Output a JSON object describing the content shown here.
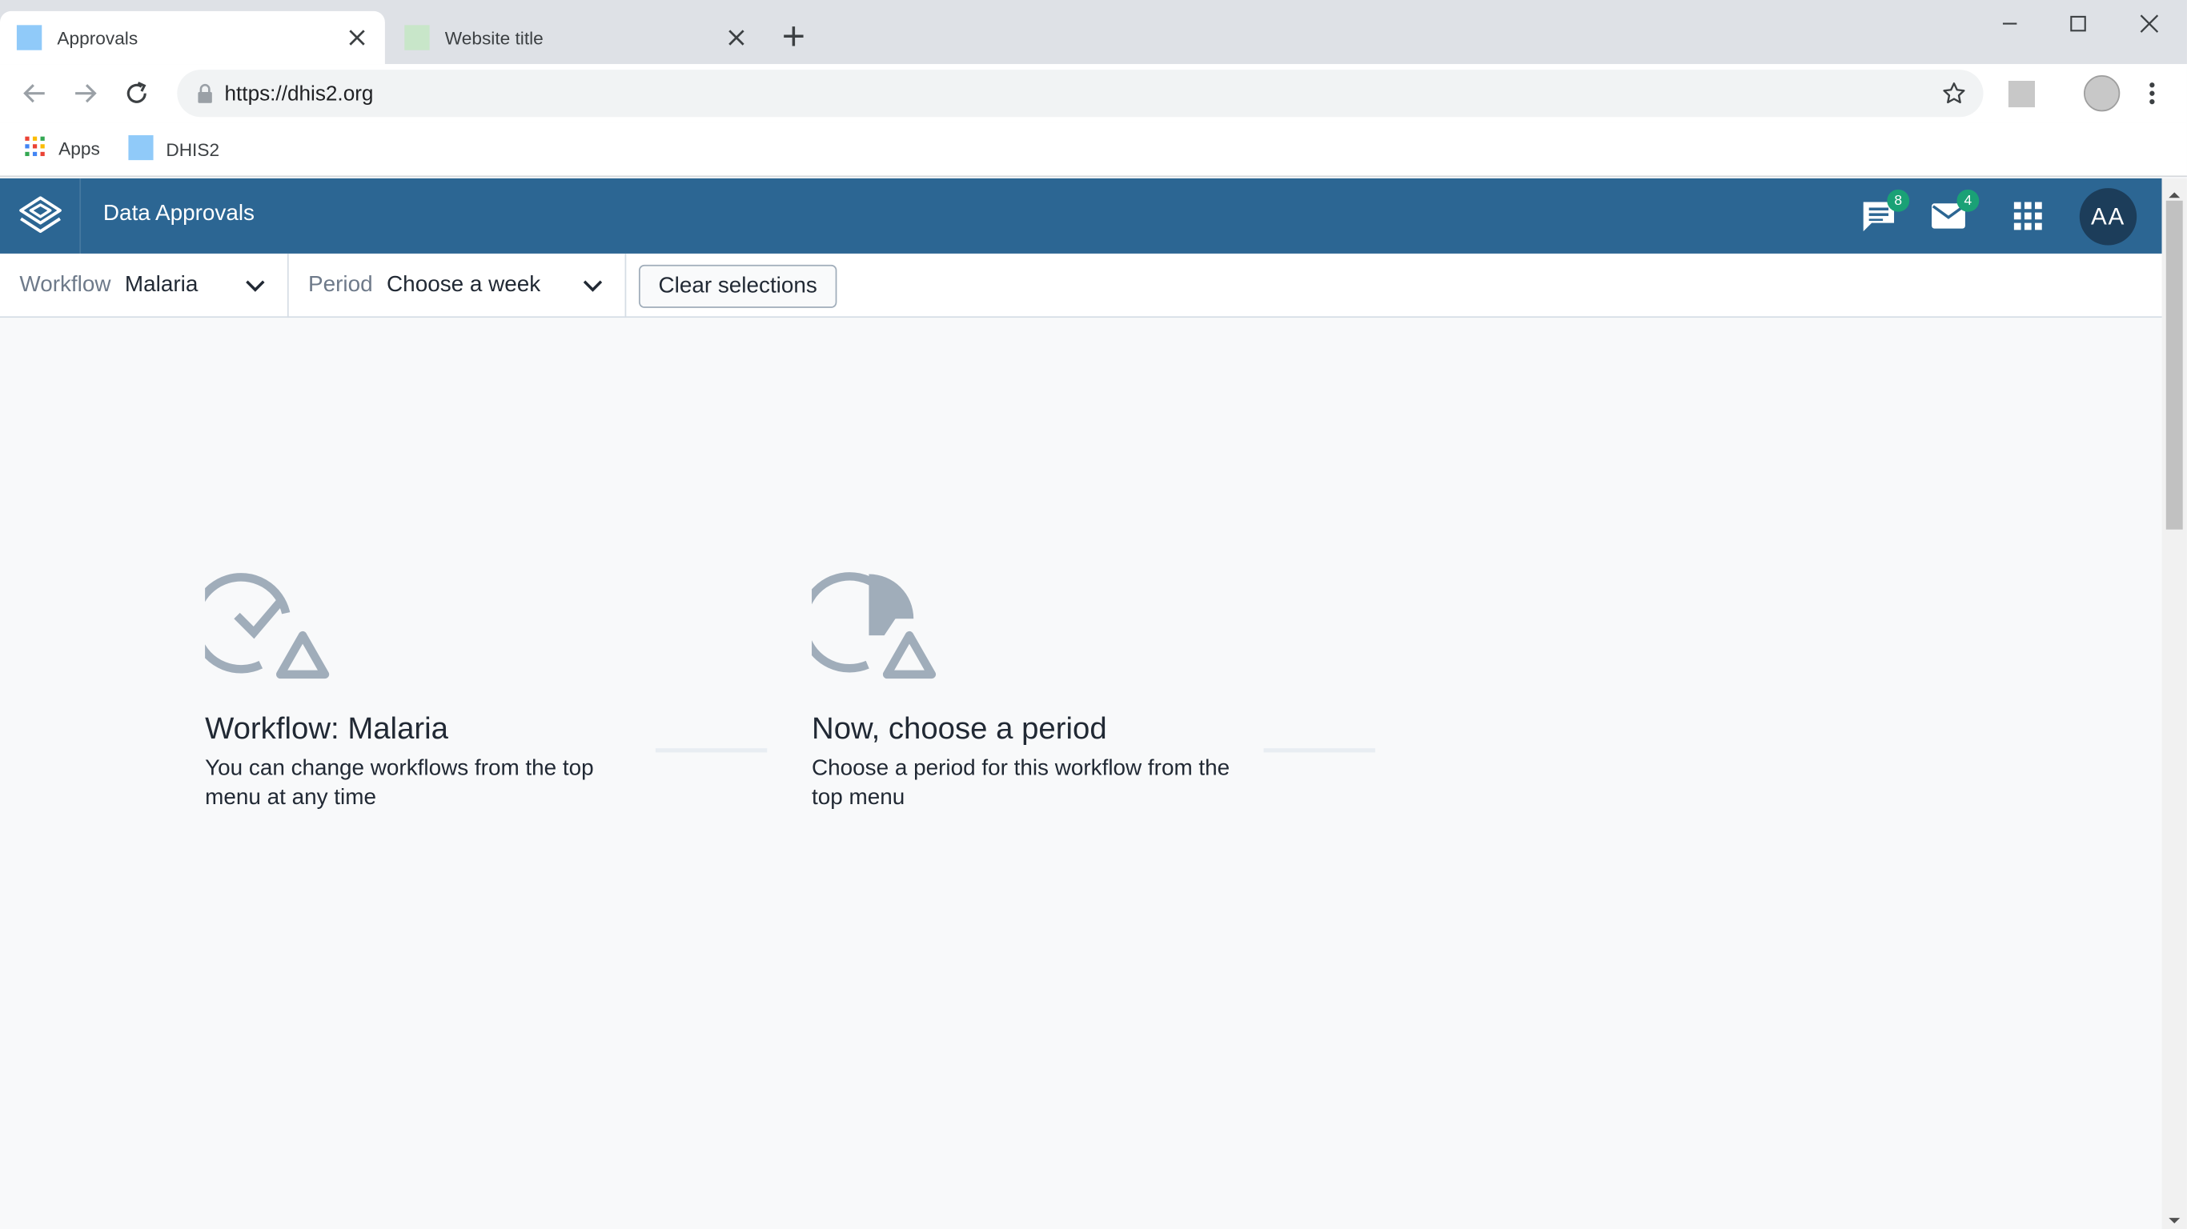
{
  "browser": {
    "tabs": [
      {
        "title": "Approvals",
        "favicon_color": "#90caf9",
        "active": true
      },
      {
        "title": "Website title",
        "favicon_color": "#c8e6c9",
        "active": false
      }
    ],
    "url": "https://dhis2.org",
    "bookmarks": [
      {
        "label": "Apps",
        "icon": "apps-grid-icon"
      },
      {
        "label": "DHIS2",
        "icon": "folder-icon",
        "icon_color": "#90caf9"
      }
    ]
  },
  "header": {
    "title": "Data Approvals",
    "interpretations_count": "8",
    "messages_count": "4",
    "avatar_initials": "AA",
    "bar_color": "#2c6693",
    "badge_color": "#1aa176"
  },
  "selection": {
    "workflow_label": "Workflow",
    "workflow_value": "Malaria",
    "period_label": "Period",
    "period_value": "Choose a week",
    "clear_label": "Clear selections"
  },
  "steps": [
    {
      "title": "Workflow: Malaria",
      "text": "You can change workflows from the top menu at any time",
      "icon": "workflow-check-warning-icon"
    },
    {
      "title": "Now, choose a period",
      "text": "Choose a period for this workflow from the top menu",
      "icon": "period-clock-warning-icon"
    }
  ]
}
